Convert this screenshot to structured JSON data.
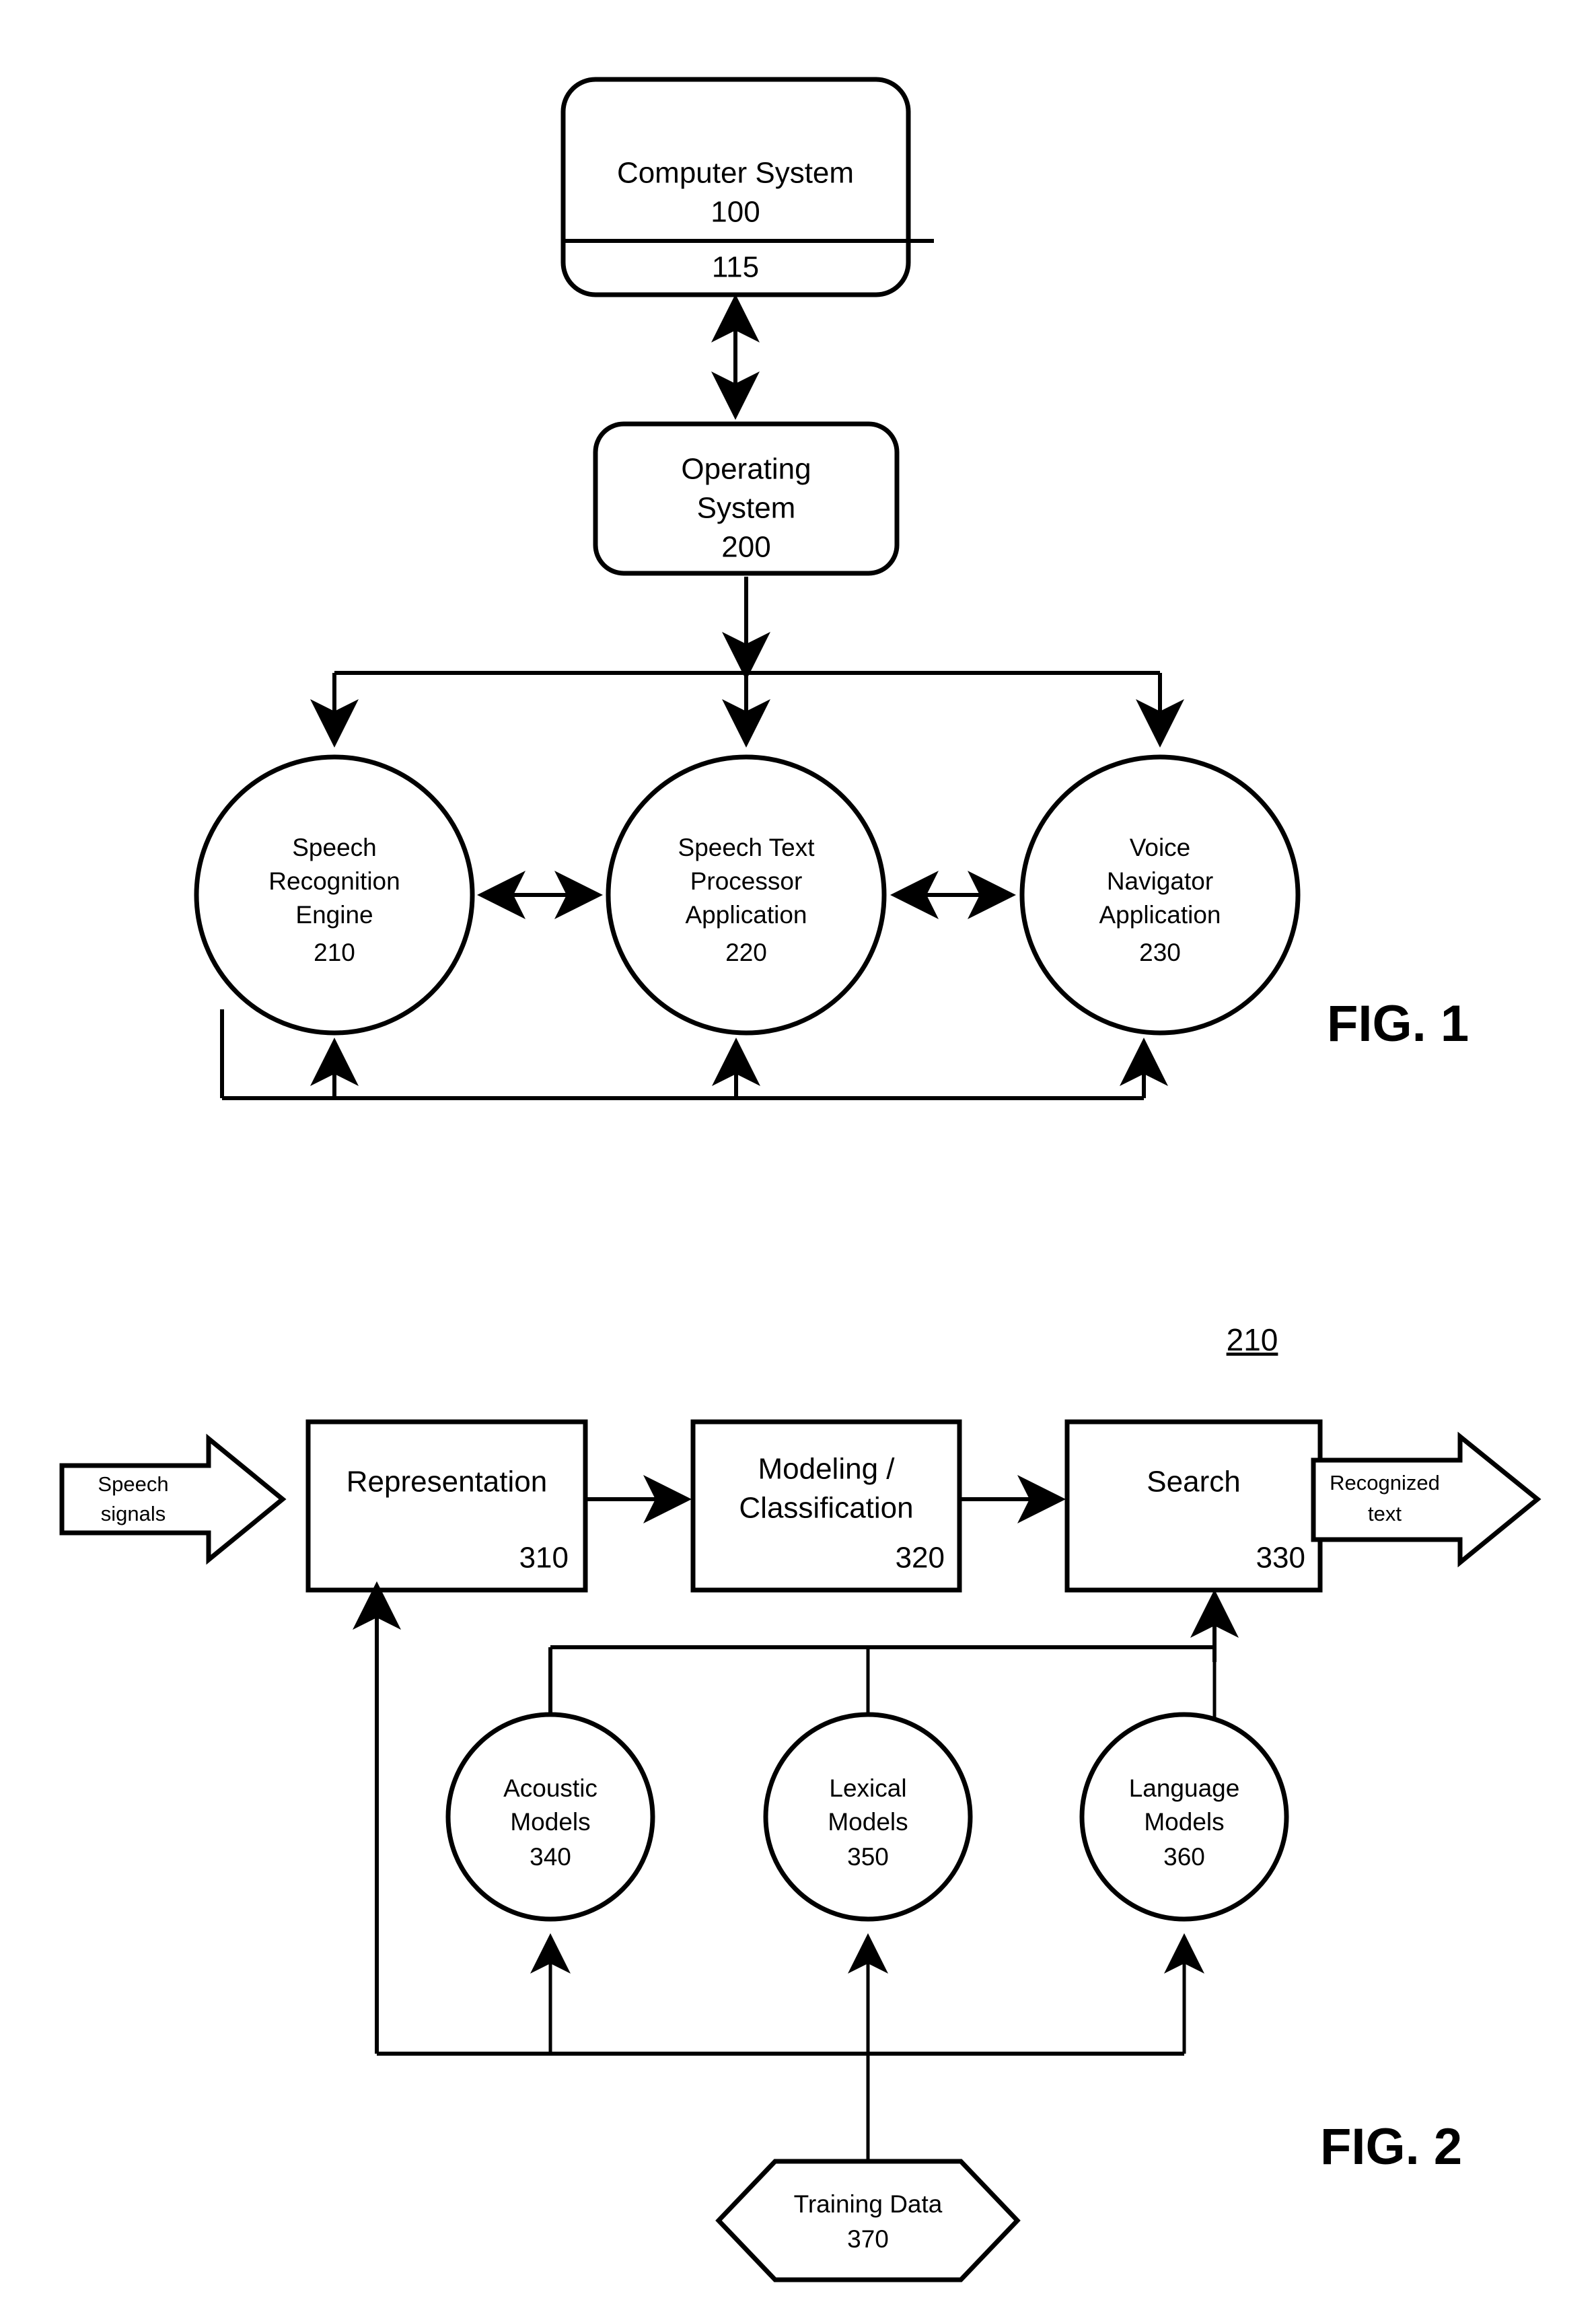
{
  "document": {
    "type": "patent-drawing-sheet",
    "figure_labels": {
      "fig1": "FIG. 1",
      "fig2": "FIG. 2"
    },
    "reference_marks": {
      "fig2_system_ref": "210"
    }
  },
  "fig1": {
    "computer_system": {
      "title": "Computer System",
      "number": "100",
      "bus_number": "115"
    },
    "operating_system": {
      "line1": "Operating",
      "line2": "System",
      "number": "200"
    },
    "components": [
      {
        "id": "speech-recognition-engine",
        "line1": "Speech",
        "line2": "Recognition",
        "line3": "Engine",
        "number": "210"
      },
      {
        "id": "speech-text-processor-application",
        "line1": "Speech Text",
        "line2": "Processor",
        "line3": "Application",
        "number": "220"
      },
      {
        "id": "voice-navigator-application",
        "line1": "Voice",
        "line2": "Navigator",
        "line3": "Application",
        "number": "230"
      }
    ]
  },
  "fig2": {
    "input_arrow": {
      "line1": "Speech",
      "line2": "signals"
    },
    "output_arrow": {
      "line1": "Recognized",
      "line2": "text"
    },
    "process_boxes": [
      {
        "id": "representation",
        "line1": "Representation",
        "line2": "",
        "number": "310"
      },
      {
        "id": "modeling-classification",
        "line1": "Modeling /",
        "line2": "Classification",
        "number": "320"
      },
      {
        "id": "search",
        "line1": "Search",
        "line2": "",
        "number": "330"
      }
    ],
    "model_circles": [
      {
        "id": "acoustic-models",
        "line1": "Acoustic",
        "line2": "Models",
        "number": "340"
      },
      {
        "id": "lexical-models",
        "line1": "Lexical",
        "line2": "Models",
        "number": "350"
      },
      {
        "id": "language-models",
        "line1": "Language",
        "line2": "Models",
        "number": "360"
      }
    ],
    "training_data": {
      "id": "training-data",
      "label": "Training Data",
      "number": "370"
    }
  },
  "style": {
    "ink": "#000000",
    "paper": "#ffffff"
  }
}
